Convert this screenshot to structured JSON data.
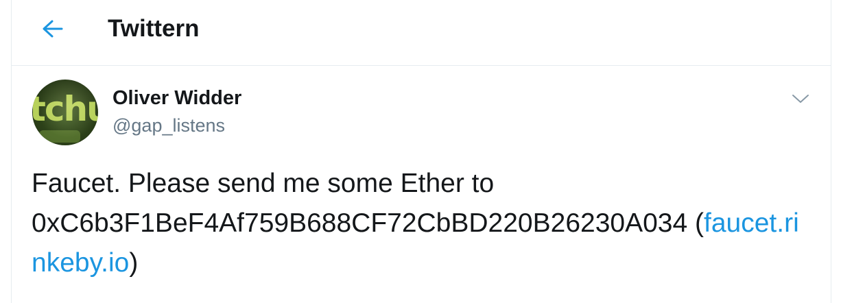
{
  "header": {
    "title": "Twittern",
    "back_icon": "arrow-left-icon"
  },
  "tweet": {
    "author_name": "Oliver Widder",
    "author_handle": "@gap_listens",
    "avatar_text": "tchu",
    "text_line1": "Faucet. Please send me some Ether to",
    "address": "0xC6b3F1BeF4Af759B688CF72CbBD220B26230A034",
    "link_open": " (",
    "link_text": "faucet.rinkeby.io",
    "link_close": ")",
    "menu_icon": "chevron-down-icon"
  },
  "colors": {
    "accent": "#1b95e0",
    "text": "#14171a",
    "secondary": "#657786",
    "border": "#e6ecf0"
  }
}
